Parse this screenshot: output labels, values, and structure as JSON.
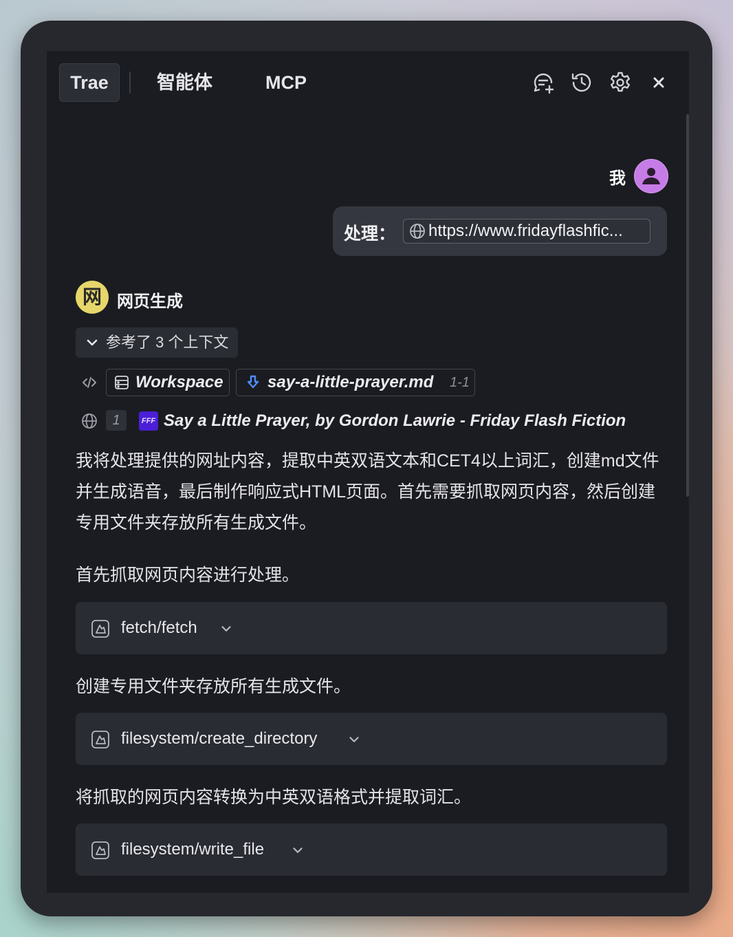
{
  "header": {
    "tabs": [
      {
        "label": "Trae",
        "active": true
      },
      {
        "label": "智能体",
        "active": false
      },
      {
        "label": "MCP",
        "active": false
      }
    ],
    "icons": [
      "new-chat-icon",
      "history-icon",
      "gear-icon",
      "close-icon"
    ]
  },
  "user": {
    "name": "我",
    "message_prefix": "处理：",
    "url_chip": "https://www.fridayflashfic..."
  },
  "agent": {
    "name": "网页生成",
    "avatar_char": "网",
    "avatar_color": "#e7d66a",
    "context_toggle": "参考了 3 个上下文",
    "context_items": {
      "workspace": "Workspace",
      "file_name": "say-a-little-prayer.md",
      "file_range": "1-1",
      "web_index": "1",
      "web_badge": "FFF",
      "web_title": "Say a Little Prayer, by Gordon Lawrie - Friday Flash Fiction"
    },
    "paragraph1": "我将处理提供的网址内容，提取中英双语文本和CET4以上词汇，创建md文件并生成语音，最后制作响应式HTML页面。首先需要抓取网页内容，然后创建专用文件夹存放所有生成文件。",
    "step1_text": "首先抓取网页内容进行处理。",
    "tool1": "fetch/fetch",
    "step2_text": "创建专用文件夹存放所有生成文件。",
    "tool2": "filesystem/create_directory",
    "step3_text": "将抓取的网页内容转换为中英双语格式并提取词汇。",
    "tool3": "filesystem/write_file"
  },
  "colors": {
    "window_bg": "#26282d",
    "panel_bg": "#1b1c21",
    "card_bg": "#2a2c33",
    "avatar_user": "#c67ce6",
    "accent_blue": "#4e8cff"
  }
}
